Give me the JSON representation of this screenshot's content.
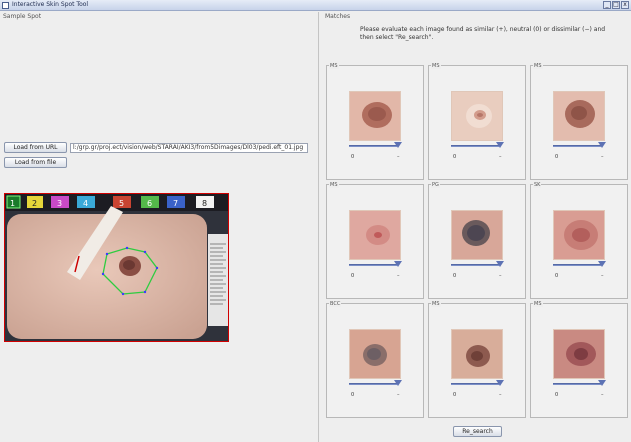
{
  "window": {
    "title": "Interactive Skin Spot Tool",
    "controls": [
      "_",
      "□",
      "x"
    ]
  },
  "left": {
    "section_label": "Sample Spot",
    "load_url_label": "Load from URL",
    "load_file_label": "Load from file",
    "url_value": "l:/grp.gr/proj.ect/vision/web/STARAI/AKI3/from5Dimages/Dl03/pedi.eft_01.jpg",
    "ruler_badges": [
      "1",
      "2",
      "3",
      "4",
      "5",
      "6",
      "7",
      "8"
    ]
  },
  "right": {
    "section_label": "Matches",
    "instructions": "Please evaluate each image found as similar (+), neutral (0) or dissimilar (−) and then select \"Re_search\".",
    "research_label": "Re_search",
    "matches": [
      {
        "label": "MS",
        "min_label": "0",
        "max_label": "–"
      },
      {
        "label": "MS",
        "min_label": "0",
        "max_label": "–"
      },
      {
        "label": "MS",
        "min_label": "0",
        "max_label": "–"
      },
      {
        "label": "MS",
        "min_label": "0",
        "max_label": "–"
      },
      {
        "label": "PG",
        "min_label": "0",
        "max_label": "–"
      },
      {
        "label": "SK",
        "min_label": "0",
        "max_label": "–"
      },
      {
        "label": "BCC",
        "min_label": "0",
        "max_label": "–"
      },
      {
        "label": "MS",
        "min_label": "0",
        "max_label": "–"
      },
      {
        "label": "MS",
        "min_label": "0",
        "max_label": "–"
      }
    ]
  },
  "colors": {
    "selection_frame": "#d00000",
    "lesion_outline": "#2ecc40",
    "slider": "#5d72b4"
  }
}
